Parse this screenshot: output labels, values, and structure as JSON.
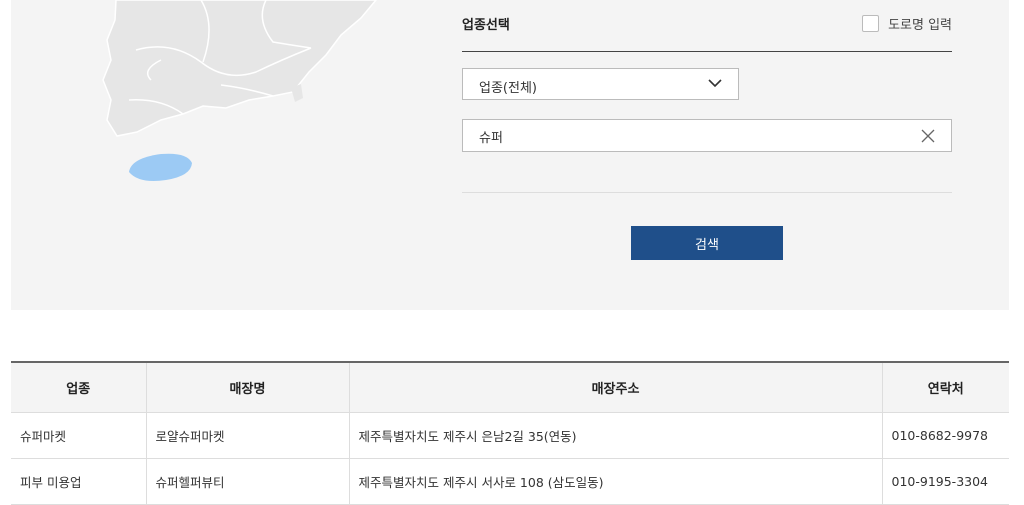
{
  "form": {
    "section_title": "업종선택",
    "road_name_label": "도로명 입력",
    "road_name_checked": false,
    "category_select_value": "업종(전체)",
    "search_value": "슈퍼",
    "search_button_label": "검색"
  },
  "icons": {
    "dropdown": "chevron-down-icon",
    "clear": "close-icon",
    "checkbox": "checkbox-icon"
  },
  "colors": {
    "panel_bg": "#f4f4f4",
    "map_land": "#e6e6e6",
    "map_highlight": "#9ccaf4",
    "button": "#1f4f8a"
  },
  "table": {
    "headers": [
      "업종",
      "매장명",
      "매장주소",
      "연락처"
    ],
    "rows": [
      [
        "슈퍼마켓",
        "로얄슈퍼마켓",
        "제주특별자치도 제주시 은남2길 35(연동)",
        "010-8682-9978"
      ],
      [
        "피부 미용업",
        "슈퍼헬퍼뷰티",
        "제주특별자치도 제주시 서사로 108 (삼도일동)",
        "010-9195-3304"
      ]
    ]
  }
}
